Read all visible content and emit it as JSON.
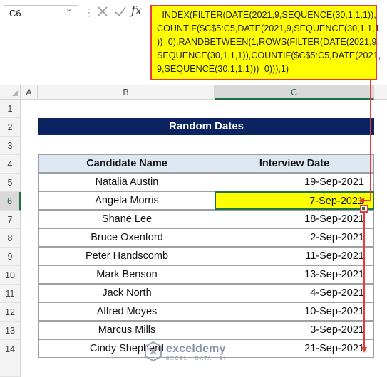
{
  "formula_bar": {
    "name_box": "C6",
    "cancel_icon": "x-icon",
    "enter_icon": "check-icon",
    "fx_label": "fx",
    "formula_lines": [
      "=INDEX(FILTER(DATE(2021,9,SEQUENCE(30,1,1,1)),",
      "COUNTIF($C$5:C5,DATE(2021,9,SEQUENCE(30,1,1,1",
      "))=0),RANDBETWEEN(1,ROWS(FILTER(DATE(2021,9,",
      "SEQUENCE(30,1,1,1)),COUNTIF($C$5:C5,DATE(2021,",
      "9,SEQUENCE(30,1,1,1)))=0))),1)"
    ]
  },
  "columns": [
    "A",
    "B",
    "C"
  ],
  "rows": [
    "1",
    "2",
    "3",
    "4",
    "5",
    "6",
    "7",
    "8",
    "9",
    "10",
    "11",
    "12",
    "13",
    "14"
  ],
  "active_row": "6",
  "sheet": {
    "title": "Random Dates",
    "headers": {
      "name": "Candidate Name",
      "date": "Interview Date"
    },
    "records": [
      {
        "name": "Natalia Austin",
        "date": "19-Sep-2021"
      },
      {
        "name": "Angela Morris",
        "date": "7-Sep-2021"
      },
      {
        "name": "Shane Lee",
        "date": "18-Sep-2021"
      },
      {
        "name": "Bruce Oxenford",
        "date": "2-Sep-2021"
      },
      {
        "name": "Peter Handscomb",
        "date": "11-Sep-2021"
      },
      {
        "name": "Mark Benson",
        "date": "13-Sep-2021"
      },
      {
        "name": "Jack North",
        "date": "4-Sep-2021"
      },
      {
        "name": "Alfred Moyes",
        "date": "10-Sep-2021"
      },
      {
        "name": "Marcus Mills",
        "date": "3-Sep-2021"
      },
      {
        "name": "Cindy Shepherd",
        "date": "21-Sep-2021"
      }
    ],
    "selected_record": 1
  },
  "watermark": {
    "name": "exceldemy",
    "tagline": "EXCEL · DATA · BI"
  },
  "colors": {
    "highlight": "#ffff00",
    "annotation": "#e8393d",
    "title_bg": "#0b2461",
    "header_bg": "#dde8f3",
    "selection": "#217346"
  }
}
